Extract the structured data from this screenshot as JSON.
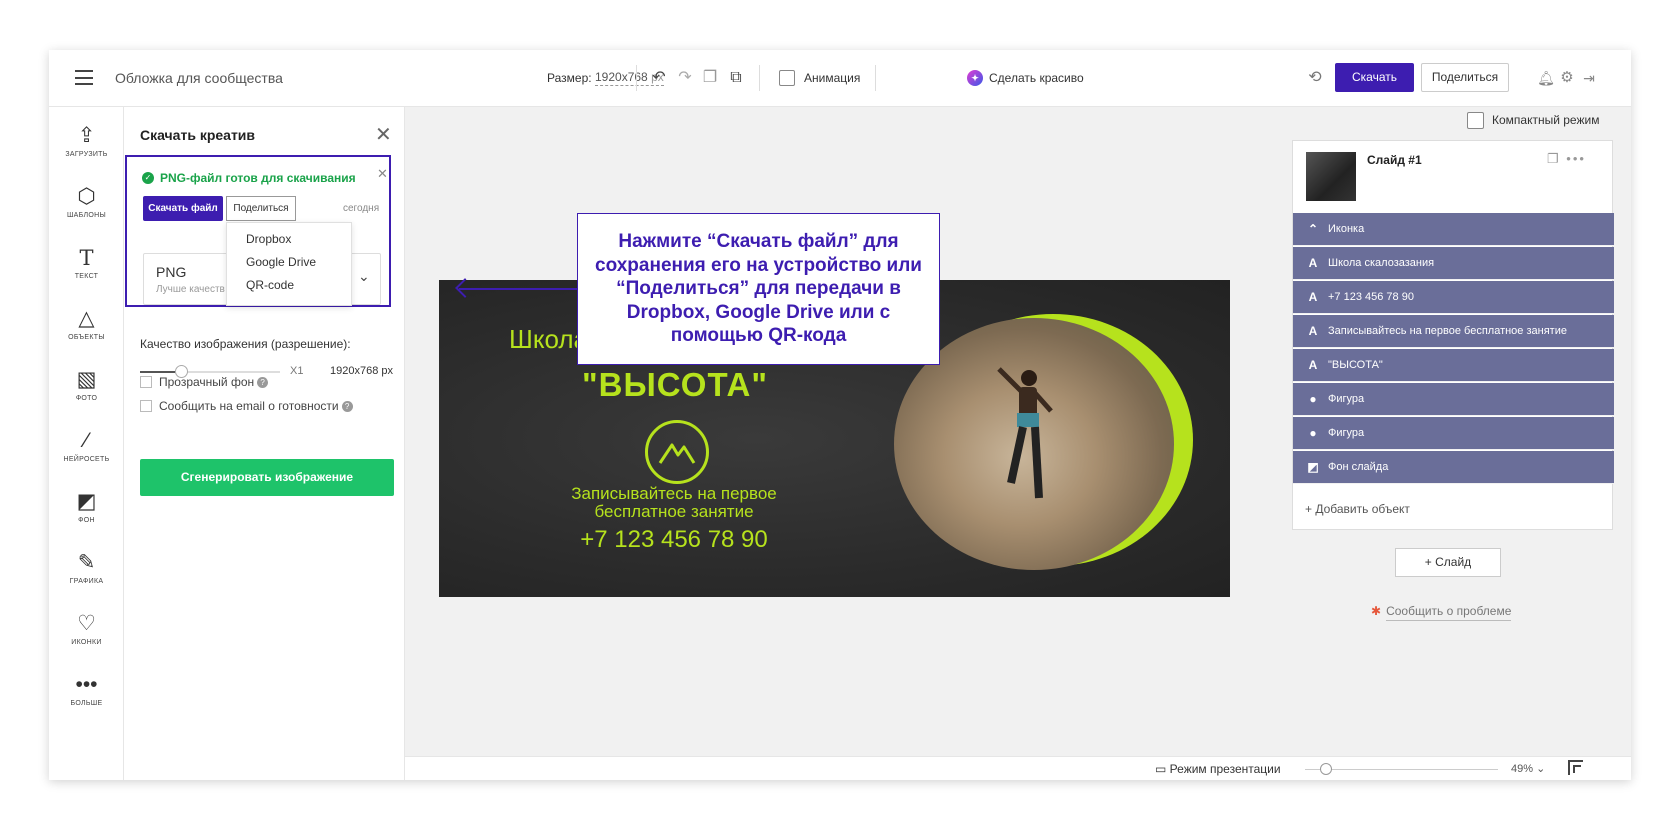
{
  "header": {
    "doc_title": "Обложка для сообщества",
    "size_label": "Размер:",
    "size_value": "1920x768",
    "size_unit": "px",
    "animation_label": "Анимация",
    "beautify_label": "Сделать красиво",
    "download_label": "Скачать",
    "share_label": "Поделиться"
  },
  "rail": {
    "items": [
      {
        "label": "ЗАГРУЗИТЬ",
        "icon": "upload-icon"
      },
      {
        "label": "ШАБЛОНЫ",
        "icon": "templates-icon"
      },
      {
        "label": "ТЕКСТ",
        "icon": "text-icon"
      },
      {
        "label": "ОБЪЕКТЫ",
        "icon": "shapes-icon"
      },
      {
        "label": "ФОТО",
        "icon": "photo-icon"
      },
      {
        "label": "НЕЙРОСЕТЬ",
        "icon": "magic-wand-icon"
      },
      {
        "label": "ФОН",
        "icon": "background-icon"
      },
      {
        "label": "ГРАФИКА",
        "icon": "brush-icon"
      },
      {
        "label": "ИКОНКИ",
        "icon": "heart-icon"
      },
      {
        "label": "БОЛЬШЕ",
        "icon": "more-icon"
      }
    ]
  },
  "panel": {
    "title": "Скачать креатив",
    "notice": "PNG-файл готов для скачивания",
    "download_file": "Скачать файл",
    "share": "Поделиться",
    "date": "сегодня",
    "share_options": [
      "Dropbox",
      "Google Drive",
      "QR-code"
    ],
    "format_name": "PNG",
    "format_desc": "Лучше качеств",
    "quality_label": "Качество изображения (разрешение):",
    "quality_multiplier": "X1",
    "quality_resolution": "1920x768 px",
    "quality_level": 0.25,
    "option_transparent": "Прозрачный фон",
    "option_email": "Сообщить на email о готовности",
    "generate": "Сгенерировать изображение"
  },
  "callout": {
    "text": "Нажмите “Скачать файл” для сохранения его на устройство или “Поделиться” для передачи в Dropbox, Google Drive или с помощью QR-кода"
  },
  "banner": {
    "title": "Школа скалозазания",
    "subtitle": "\"ВЫСОТА\"",
    "invite": "Записывайтесь на первое бесплатное занятие",
    "phone": "+7 123 456 78 90",
    "accent": "#b6e21d"
  },
  "layers": {
    "compact_mode": "Компактный режим",
    "slide_name": "Слайд #1",
    "items": [
      {
        "label": "Иконка",
        "icon": "mountain-icon"
      },
      {
        "label": "Школа скалозазания",
        "icon": "text-icon"
      },
      {
        "label": "+7 123 456 78 90",
        "icon": "text-icon"
      },
      {
        "label": "Записывайтесь на первое бесплатное занятие",
        "icon": "text-icon"
      },
      {
        "label": "\"ВЫСОТА\"",
        "icon": "text-icon"
      },
      {
        "label": "Фигура",
        "icon": "circle-icon"
      },
      {
        "label": "Фигура",
        "icon": "circle-icon"
      },
      {
        "label": "Фон слайда",
        "icon": "background-icon"
      }
    ],
    "add_object": "Добавить объект",
    "add_slide": "Слайд",
    "report": "Сообщить о проблеме"
  },
  "footer": {
    "presentation_mode": "Режим презентации",
    "zoom": "49%"
  },
  "colors": {
    "primary": "#3d1db0",
    "success": "#1ec36a",
    "layer_bg": "#6a6e99"
  }
}
